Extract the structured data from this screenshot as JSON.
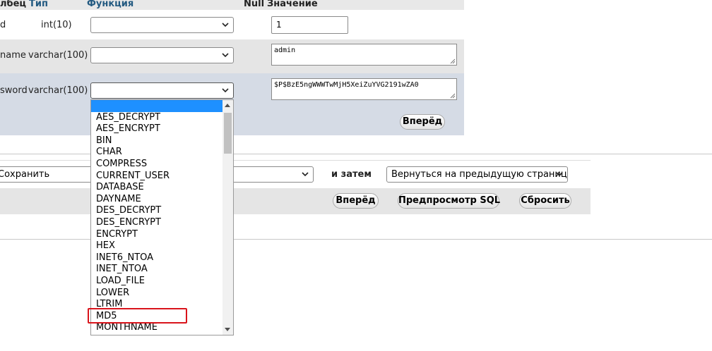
{
  "header": {
    "column": "лбец",
    "type": "Тип",
    "function": "Функция",
    "null": "Null",
    "value": "Значение"
  },
  "rows": [
    {
      "name": "d",
      "type": "int(10)",
      "function": "",
      "value": "1"
    },
    {
      "name": "name",
      "type": "varchar(100)",
      "function": "",
      "value": "admin"
    },
    {
      "name": "sword",
      "type": "varchar(100)",
      "function": "",
      "value": "$P$BzE5ngWWWTwMjH5XeiZuYVG2191wZA0"
    }
  ],
  "row_action": {
    "go_label": "Вперёд"
  },
  "bottom": {
    "save_select": "Сохранить",
    "and_then_label": "и затем",
    "then_select": "Вернуться на предыдущую страницу",
    "go_label": "Вперёд",
    "preview_label": "Предпросмотр SQL",
    "reset_label": "Сбросить"
  },
  "function_dropdown": {
    "options": [
      "",
      "AES_DECRYPT",
      "AES_ENCRYPT",
      "BIN",
      "CHAR",
      "COMPRESS",
      "CURRENT_USER",
      "DATABASE",
      "DAYNAME",
      "DES_DECRYPT",
      "DES_ENCRYPT",
      "ENCRYPT",
      "HEX",
      "INET6_NTOA",
      "INET_NTOA",
      "LOAD_FILE",
      "LOWER",
      "LTRIM",
      "MD5",
      "MONTHNAME"
    ],
    "selected_index": 0,
    "highlighted_option": "MD5"
  },
  "colors": {
    "header_link": "#235a81",
    "selected_option": "#1e90ff",
    "highlight_border": "#d9141b"
  },
  "icons": [
    "chevron-down-icon",
    "scroll-up-icon",
    "scroll-down-icon",
    "resize-grip-icon"
  ]
}
